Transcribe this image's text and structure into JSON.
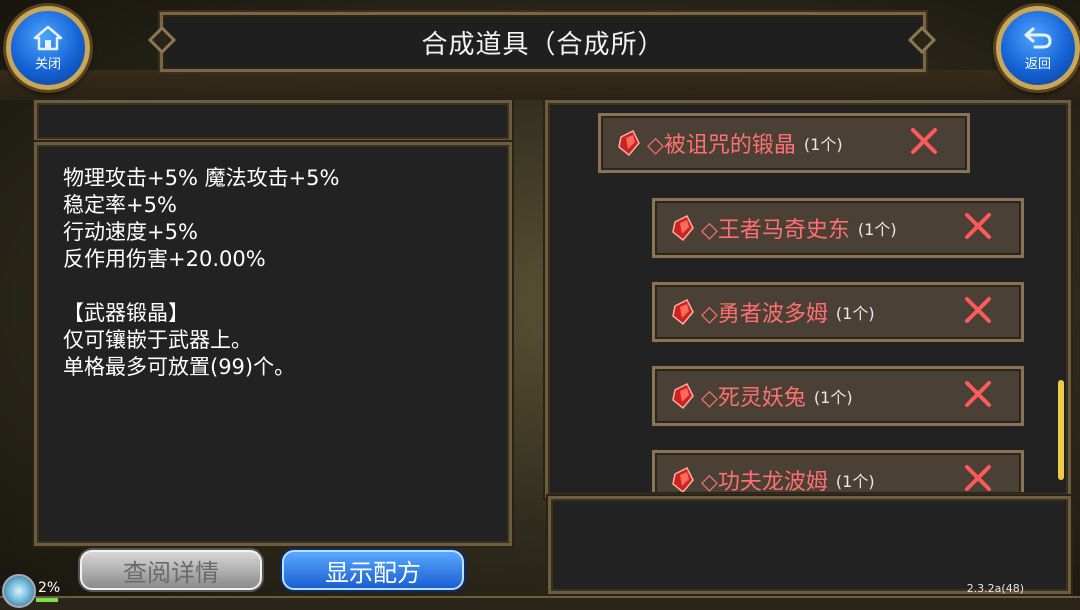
{
  "header": {
    "title": "合成道具（合成所）"
  },
  "buttons": {
    "close_label": "关闭",
    "back_label": "返回",
    "detail_label": "查阅详情",
    "recipe_label": "显示配方"
  },
  "description": {
    "lines": [
      "物理攻击+5% 魔法攻击+5%",
      "稳定率+5%",
      "行动速度+5%",
      "反作用伤害+20.00%",
      "",
      "【武器锻晶】",
      "仅可镶嵌于武器上。",
      "单格最多可放置(99)个。"
    ]
  },
  "materials": [
    {
      "name": "◇被诅咒的锻晶",
      "qty": "(1个)"
    },
    {
      "name": "◇王者马奇史东",
      "qty": "(1个)"
    },
    {
      "name": "◇勇者波多姆",
      "qty": "(1个)"
    },
    {
      "name": "◇死灵妖兔",
      "qty": "(1个)"
    },
    {
      "name": "◇功夫龙波姆",
      "qty": "(1个)"
    }
  ],
  "status": {
    "percent": "2%",
    "version": "2.3.2a(48)"
  },
  "colors": {
    "item_name": "#ff7070",
    "remove_x": "#ff5a5a",
    "accent_blue": "#1563d6",
    "frame": "#6e5c3e"
  },
  "icons": {
    "close": "home-icon",
    "back": "return-arrow-icon",
    "gem": "red-crystal-icon",
    "remove": "x-icon"
  }
}
